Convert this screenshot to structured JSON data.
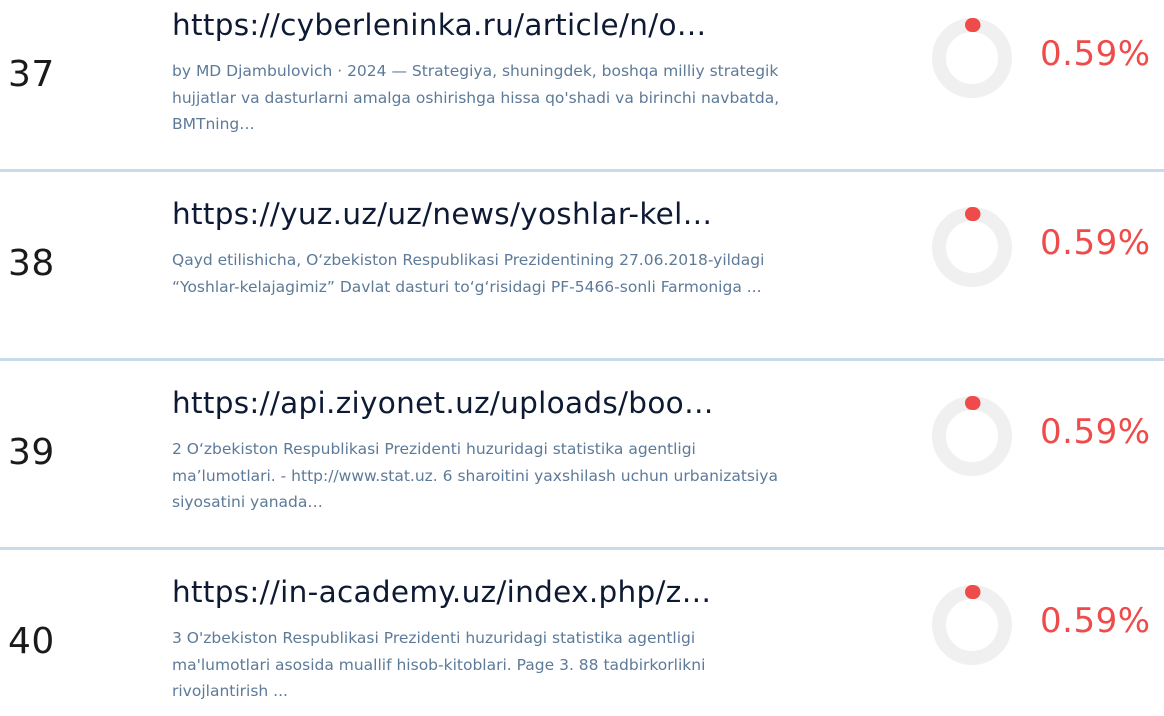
{
  "results": [
    {
      "index": "37",
      "url": "https://cyberleninka.ru/article/n/o…",
      "snippet": "by MD Djambulovich · 2024 — Strategiya, shuningdek, boshqa milliy strategik hujjatlar va dasturlarni amalga oshirishga hissa qo'shadi va birinchi navbatda, BMTning…",
      "percent": "0.59%",
      "percent_value": 0.59
    },
    {
      "index": "38",
      "url": "https://yuz.uz/uz/news/yoshlar-kel…",
      "snippet": "Qayd etilishicha, O‘zbekiston Respublikasi Prezidentining 27.06.2018-yildagi “Yoshlar-kelajagimiz” Davlat dasturi to‘g‘risidagi PF-5466-sonli Farmoniga ...",
      "percent": "0.59%",
      "percent_value": 0.59
    },
    {
      "index": "39",
      "url": "https://api.ziyonet.uz/uploads/boo…",
      "snippet": "2 O‘zbekiston Respublikasi Prezidenti huzuridagi statistika agentligi ma’lumotlari. - http://www.stat.uz. 6 sharoitini yaxshilash uchun urbanizatsiya siyosatini yanada…",
      "percent": "0.59%",
      "percent_value": 0.59
    },
    {
      "index": "40",
      "url": "https://in-academy.uz/index.php/z…",
      "snippet": "3 O'zbekiston Respublikasi Prezidenti huzuridagi statistika agentligi ma'lumotlari asosida muallif hisob-kitoblari. Page 3. 88 tadbirkorlikni rivojlantirish ...",
      "percent": "0.59%",
      "percent_value": 0.59
    }
  ],
  "colors": {
    "url": "#0e1a33",
    "snippet": "#5d7a99",
    "percent": "#ef4b4b",
    "ring_track": "#f0f0f0",
    "ring_fill": "#ef4b4b",
    "divider": "#c9dbe9",
    "index": "#1a1a1a"
  }
}
